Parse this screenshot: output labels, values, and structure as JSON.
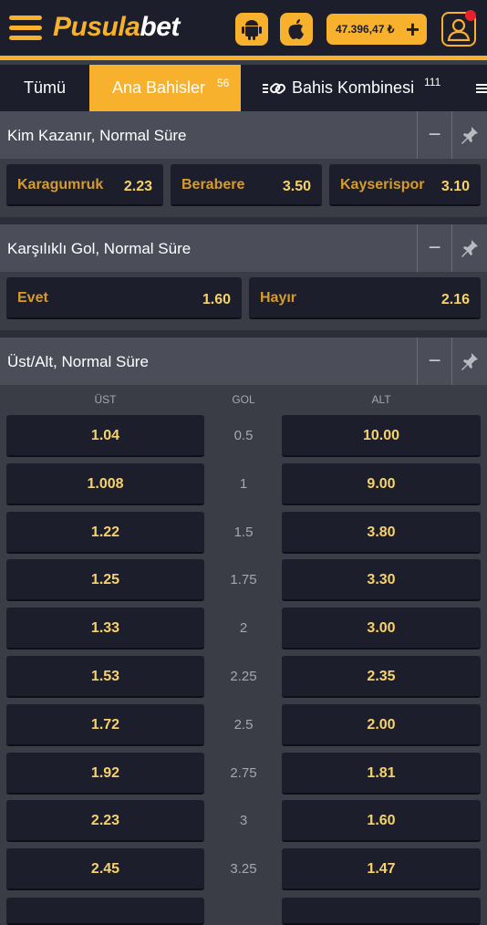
{
  "header": {
    "logo_part1": "Pusula",
    "logo_part2": "bet",
    "balance": "47.396,47 ₺",
    "plus": "+"
  },
  "tabs": [
    {
      "label": "Tümü"
    },
    {
      "label": "Ana Bahisler",
      "count": "56"
    },
    {
      "label": "Bahis Kombinesi",
      "count": "111"
    }
  ],
  "markets": {
    "winner": {
      "title": "Kim Kazanır, Normal Süre",
      "outcomes": [
        {
          "name": "Karagumruk",
          "odd": "2.23"
        },
        {
          "name": "Berabere",
          "odd": "3.50"
        },
        {
          "name": "Kayserispor",
          "odd": "3.10"
        }
      ]
    },
    "btts": {
      "title": "Karşılıklı Gol, Normal Süre",
      "outcomes": [
        {
          "name": "Evet",
          "odd": "1.60"
        },
        {
          "name": "Hayır",
          "odd": "2.16"
        }
      ]
    },
    "overunder": {
      "title": "Üst/Alt, Normal Süre",
      "col_over": "ÜST",
      "col_goal": "GOL",
      "col_under": "ALT",
      "rows": [
        {
          "over": "1.04",
          "goal": "0.5",
          "under": "10.00"
        },
        {
          "over": "1.008",
          "goal": "1",
          "under": "9.00"
        },
        {
          "over": "1.22",
          "goal": "1.5",
          "under": "3.80"
        },
        {
          "over": "1.25",
          "goal": "1.75",
          "under": "3.30"
        },
        {
          "over": "1.33",
          "goal": "2",
          "under": "3.00"
        },
        {
          "over": "1.53",
          "goal": "2.25",
          "under": "2.35"
        },
        {
          "over": "1.72",
          "goal": "2.5",
          "under": "2.00"
        },
        {
          "over": "1.92",
          "goal": "2.75",
          "under": "1.81"
        },
        {
          "over": "2.23",
          "goal": "3",
          "under": "1.60"
        },
        {
          "over": "2.45",
          "goal": "3.25",
          "under": "1.47"
        }
      ]
    }
  },
  "icons": {
    "menu": "hamburger-icon",
    "android": "android-icon",
    "apple": "apple-icon",
    "user": "user-icon",
    "collapse": "minus-icon",
    "pin": "pin-icon",
    "combine": "link-icon"
  },
  "colors": {
    "accent": "#f7b12c",
    "dark": "#1c1e2b",
    "panel": "#4b4e59"
  }
}
